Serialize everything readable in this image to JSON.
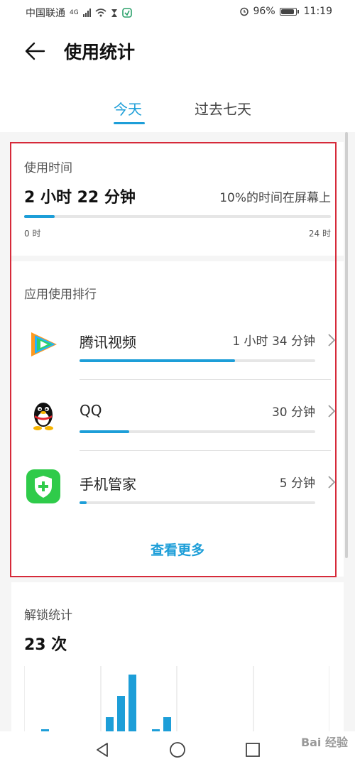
{
  "status_bar": {
    "carrier": "中国联通",
    "network": "4G",
    "battery": "96%",
    "battery_level": 0.96,
    "time": "11:19"
  },
  "header": {
    "title": "使用统计"
  },
  "tabs": [
    {
      "label": "今天",
      "active": true
    },
    {
      "label": "过去七天",
      "active": false
    }
  ],
  "usage_time": {
    "label": "使用时间",
    "value": "2 小时 22 分钟",
    "screen_note": "10%的时间在屏幕上",
    "progress": 0.1,
    "axis_start": "0 时",
    "axis_end": "24 时"
  },
  "ranking": {
    "label": "应用使用排行",
    "apps": [
      {
        "name": "腾讯视频",
        "time": "1 小时 34 分钟",
        "progress": 0.66,
        "icon": "tencent-video-icon"
      },
      {
        "name": "QQ",
        "time": "30 分钟",
        "progress": 0.21,
        "icon": "qq-penguin-icon"
      },
      {
        "name": "手机管家",
        "time": "5 分钟",
        "progress": 0.03,
        "icon": "phone-manager-shield-icon"
      }
    ],
    "more_label": "查看更多"
  },
  "unlock": {
    "label": "解锁统计",
    "value": "23 次"
  },
  "colors": {
    "accent": "#1d9ed8",
    "highlight": "#d62a3a"
  },
  "watermark": "Bai 经验"
}
